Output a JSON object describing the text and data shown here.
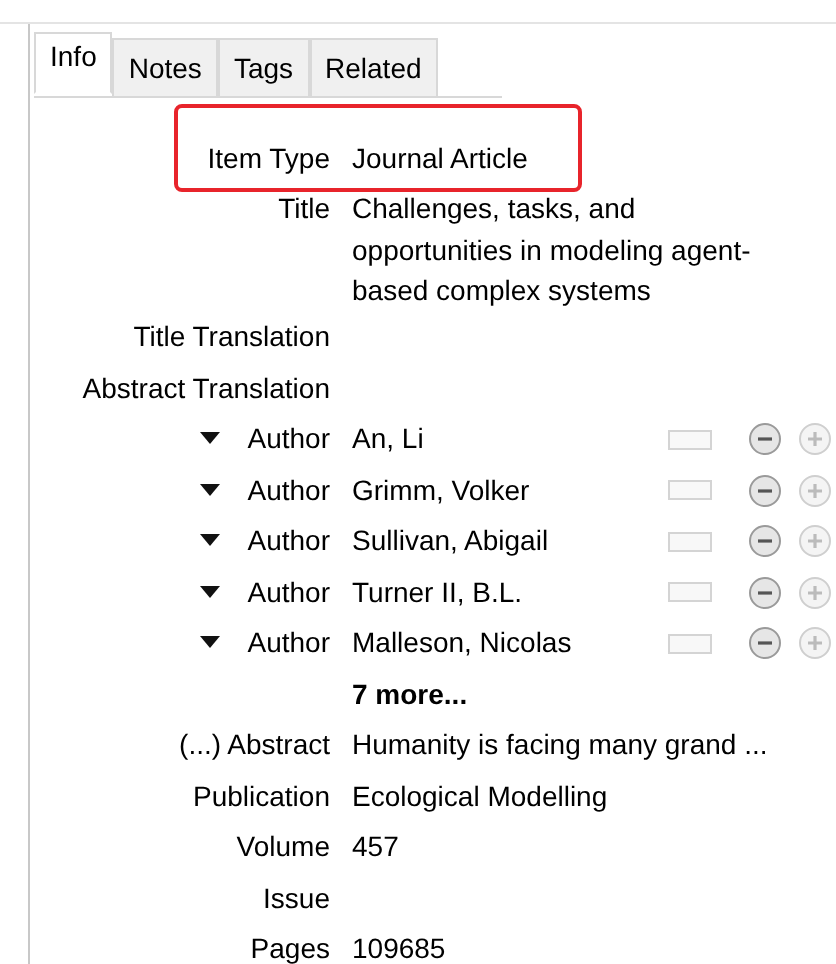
{
  "tabs": [
    {
      "label": "Info",
      "selected": true
    },
    {
      "label": "Notes",
      "selected": false
    },
    {
      "label": "Tags",
      "selected": false
    },
    {
      "label": "Related",
      "selected": false
    }
  ],
  "fields": [
    {
      "kind": "field",
      "label": "Item Type",
      "value": "Journal Article",
      "highlighted": true
    },
    {
      "kind": "multiline",
      "label": "Title",
      "value": "Challenges, tasks, and opportunities in modeling agent-based complex systems",
      "highlighted": false
    },
    {
      "kind": "field",
      "label": "Title Translation",
      "highlighted": false
    },
    {
      "kind": "field",
      "label": "Abstract Translation",
      "highlighted": false
    },
    {
      "kind": "author",
      "label": "Author",
      "value": "An, Li"
    },
    {
      "kind": "author",
      "label": "Author",
      "value": "Grimm, Volker"
    },
    {
      "kind": "author",
      "label": "Author",
      "value": "Sullivan, Abigail"
    },
    {
      "kind": "author",
      "label": "Author",
      "value": "Turner II, B.L."
    },
    {
      "kind": "author",
      "label": "Author",
      "value": "Malleson, Nicolas"
    },
    {
      "kind": "more",
      "value": "7 more..."
    },
    {
      "kind": "field",
      "label": "(...) Abstract",
      "value": "Humanity is facing many grand ...",
      "highlighted": false
    },
    {
      "kind": "field",
      "label": "Publication",
      "value": "Ecological Modelling",
      "highlighted": false
    },
    {
      "kind": "field",
      "label": "Volume",
      "value": "457",
      "highlighted": false
    },
    {
      "kind": "field",
      "label": "Issue",
      "highlighted": false
    },
    {
      "kind": "field",
      "label": "Pages",
      "value": "109685",
      "highlighted": false
    }
  ]
}
